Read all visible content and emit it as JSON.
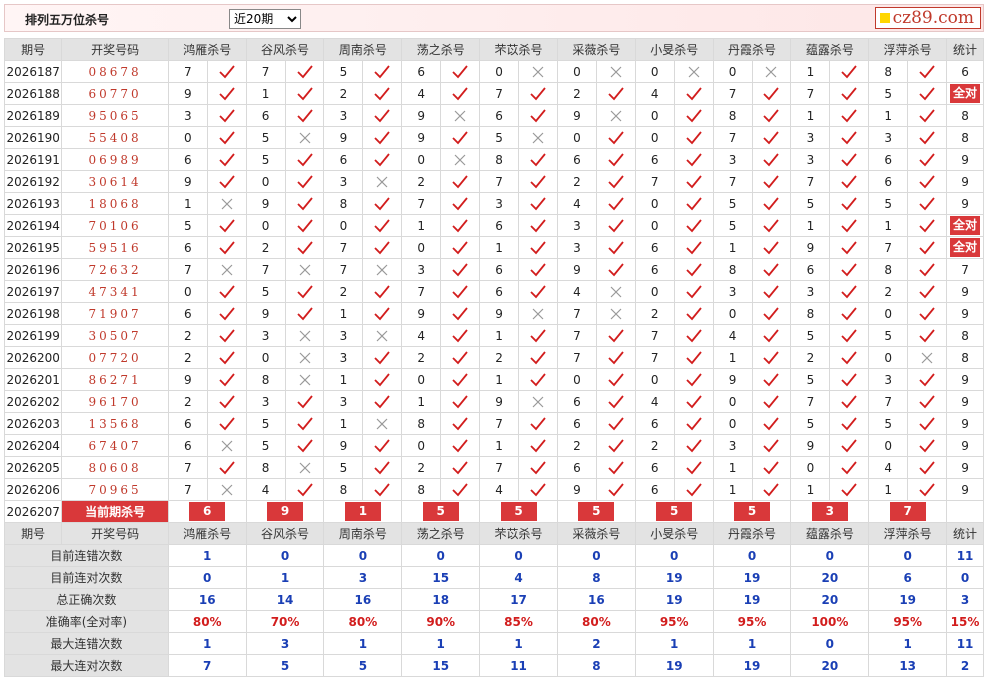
{
  "header": {
    "title": "排列五万位杀号",
    "period_select": {
      "value": "近20期",
      "options": [
        "近20期"
      ]
    }
  },
  "site_logo": "cz89.com",
  "colors": {
    "accent": "#d9383a",
    "brand": "#c0392b",
    "header_bg": "#e3e3e3",
    "stat_blue": "#1a3fb5"
  },
  "columns": {
    "issue": "期号",
    "draw": "开奖号码",
    "experts": [
      "鸿雁杀号",
      "谷风杀号",
      "周南杀号",
      "荡之杀号",
      "芣苡杀号",
      "采薇杀号",
      "小旻杀号",
      "丹霞杀号",
      "蕴露杀号",
      "浮萍杀号"
    ],
    "summary": "统计"
  },
  "icons": {
    "correct": "check-icon",
    "wrong": "cross-icon"
  },
  "rows": [
    {
      "issue": "2026187",
      "draw": "08678",
      "kills": [
        7,
        7,
        5,
        6,
        0,
        0,
        0,
        0,
        1,
        8
      ],
      "ok": [
        1,
        1,
        1,
        1,
        0,
        0,
        0,
        0,
        1,
        1
      ],
      "stat": "6"
    },
    {
      "issue": "2026188",
      "draw": "60770",
      "kills": [
        9,
        1,
        2,
        4,
        7,
        2,
        4,
        7,
        7,
        5
      ],
      "ok": [
        1,
        1,
        1,
        1,
        1,
        1,
        1,
        1,
        1,
        1
      ],
      "stat": "全对"
    },
    {
      "issue": "2026189",
      "draw": "95065",
      "kills": [
        3,
        6,
        3,
        9,
        6,
        9,
        0,
        8,
        1,
        1
      ],
      "ok": [
        1,
        1,
        1,
        0,
        1,
        0,
        1,
        1,
        1,
        1
      ],
      "stat": "8"
    },
    {
      "issue": "2026190",
      "draw": "55408",
      "kills": [
        0,
        5,
        9,
        9,
        5,
        0,
        0,
        7,
        3,
        3
      ],
      "ok": [
        1,
        0,
        1,
        1,
        0,
        1,
        1,
        1,
        1,
        1
      ],
      "stat": "8"
    },
    {
      "issue": "2026191",
      "draw": "06989",
      "kills": [
        6,
        5,
        6,
        0,
        8,
        6,
        6,
        3,
        3,
        6
      ],
      "ok": [
        1,
        1,
        1,
        0,
        1,
        1,
        1,
        1,
        1,
        1
      ],
      "stat": "9"
    },
    {
      "issue": "2026192",
      "draw": "30614",
      "kills": [
        9,
        0,
        3,
        2,
        7,
        2,
        7,
        7,
        7,
        6
      ],
      "ok": [
        1,
        1,
        0,
        1,
        1,
        1,
        1,
        1,
        1,
        1
      ],
      "stat": "9"
    },
    {
      "issue": "2026193",
      "draw": "18068",
      "kills": [
        1,
        9,
        8,
        7,
        3,
        4,
        0,
        5,
        5,
        5
      ],
      "ok": [
        0,
        1,
        1,
        1,
        1,
        1,
        1,
        1,
        1,
        1
      ],
      "stat": "9"
    },
    {
      "issue": "2026194",
      "draw": "70106",
      "kills": [
        5,
        0,
        0,
        1,
        6,
        3,
        0,
        5,
        1,
        1
      ],
      "ok": [
        1,
        1,
        1,
        1,
        1,
        1,
        1,
        1,
        1,
        1
      ],
      "stat": "全对"
    },
    {
      "issue": "2026195",
      "draw": "59516",
      "kills": [
        6,
        2,
        7,
        0,
        1,
        3,
        6,
        1,
        9,
        7
      ],
      "ok": [
        1,
        1,
        1,
        1,
        1,
        1,
        1,
        1,
        1,
        1
      ],
      "stat": "全对"
    },
    {
      "issue": "2026196",
      "draw": "72632",
      "kills": [
        7,
        7,
        7,
        3,
        6,
        9,
        6,
        8,
        6,
        8
      ],
      "ok": [
        0,
        0,
        0,
        1,
        1,
        1,
        1,
        1,
        1,
        1
      ],
      "stat": "7"
    },
    {
      "issue": "2026197",
      "draw": "47341",
      "kills": [
        0,
        5,
        2,
        7,
        6,
        4,
        0,
        3,
        3,
        2
      ],
      "ok": [
        1,
        1,
        1,
        1,
        1,
        0,
        1,
        1,
        1,
        1
      ],
      "stat": "9"
    },
    {
      "issue": "2026198",
      "draw": "71907",
      "kills": [
        6,
        9,
        1,
        9,
        9,
        7,
        2,
        0,
        8,
        0
      ],
      "ok": [
        1,
        1,
        1,
        1,
        0,
        0,
        1,
        1,
        1,
        1
      ],
      "stat": "9"
    },
    {
      "issue": "2026199",
      "draw": "30507",
      "kills": [
        2,
        3,
        3,
        4,
        1,
        7,
        7,
        4,
        5,
        5
      ],
      "ok": [
        1,
        0,
        0,
        1,
        1,
        1,
        1,
        1,
        1,
        1
      ],
      "stat": "8"
    },
    {
      "issue": "2026200",
      "draw": "07720",
      "kills": [
        2,
        0,
        3,
        2,
        2,
        7,
        7,
        1,
        2,
        0
      ],
      "ok": [
        1,
        0,
        1,
        1,
        1,
        1,
        1,
        1,
        1,
        0
      ],
      "stat": "8"
    },
    {
      "issue": "2026201",
      "draw": "86271",
      "kills": [
        9,
        8,
        1,
        0,
        1,
        0,
        0,
        9,
        5,
        3
      ],
      "ok": [
        1,
        0,
        1,
        1,
        1,
        1,
        1,
        1,
        1,
        1
      ],
      "stat": "9"
    },
    {
      "issue": "2026202",
      "draw": "96170",
      "kills": [
        2,
        3,
        3,
        1,
        9,
        6,
        4,
        0,
        7,
        7
      ],
      "ok": [
        1,
        1,
        1,
        1,
        0,
        1,
        1,
        1,
        1,
        1
      ],
      "stat": "9"
    },
    {
      "issue": "2026203",
      "draw": "13568",
      "kills": [
        6,
        5,
        1,
        8,
        7,
        6,
        6,
        0,
        5,
        5
      ],
      "ok": [
        1,
        1,
        0,
        1,
        1,
        1,
        1,
        1,
        1,
        1
      ],
      "stat": "9"
    },
    {
      "issue": "2026204",
      "draw": "67407",
      "kills": [
        6,
        5,
        9,
        0,
        1,
        2,
        2,
        3,
        9,
        0
      ],
      "ok": [
        0,
        1,
        1,
        1,
        1,
        1,
        1,
        1,
        1,
        1
      ],
      "stat": "9"
    },
    {
      "issue": "2026205",
      "draw": "80608",
      "kills": [
        7,
        8,
        5,
        2,
        7,
        6,
        6,
        1,
        0,
        4
      ],
      "ok": [
        1,
        0,
        1,
        1,
        1,
        1,
        1,
        1,
        1,
        1
      ],
      "stat": "9"
    },
    {
      "issue": "2026206",
      "draw": "70965",
      "kills": [
        7,
        4,
        8,
        8,
        4,
        9,
        6,
        1,
        1,
        1
      ],
      "ok": [
        0,
        1,
        1,
        1,
        1,
        1,
        1,
        1,
        1,
        1
      ],
      "stat": "9"
    }
  ],
  "current": {
    "issue": "2026207",
    "label": "当前期杀号",
    "kills": [
      6,
      9,
      1,
      5,
      5,
      5,
      5,
      5,
      3,
      7
    ]
  },
  "stats": [
    {
      "label": "目前连错次数",
      "values": [
        1,
        0,
        0,
        0,
        0,
        0,
        0,
        0,
        0,
        0
      ],
      "total": "11"
    },
    {
      "label": "目前连对次数",
      "values": [
        0,
        1,
        3,
        15,
        4,
        8,
        19,
        19,
        20,
        6
      ],
      "total": "0"
    },
    {
      "label": "总正确次数",
      "values": [
        16,
        14,
        16,
        18,
        17,
        16,
        19,
        19,
        20,
        19
      ],
      "total": "3"
    },
    {
      "label": "准确率(全对率)",
      "values": [
        "80%",
        "70%",
        "80%",
        "90%",
        "85%",
        "80%",
        "95%",
        "95%",
        "100%",
        "95%"
      ],
      "total": "15%"
    },
    {
      "label": "最大连错次数",
      "values": [
        1,
        3,
        1,
        1,
        1,
        2,
        1,
        1,
        0,
        1
      ],
      "total": "11"
    },
    {
      "label": "最大连对次数",
      "values": [
        7,
        5,
        5,
        15,
        11,
        8,
        19,
        19,
        20,
        13
      ],
      "total": "2"
    }
  ]
}
